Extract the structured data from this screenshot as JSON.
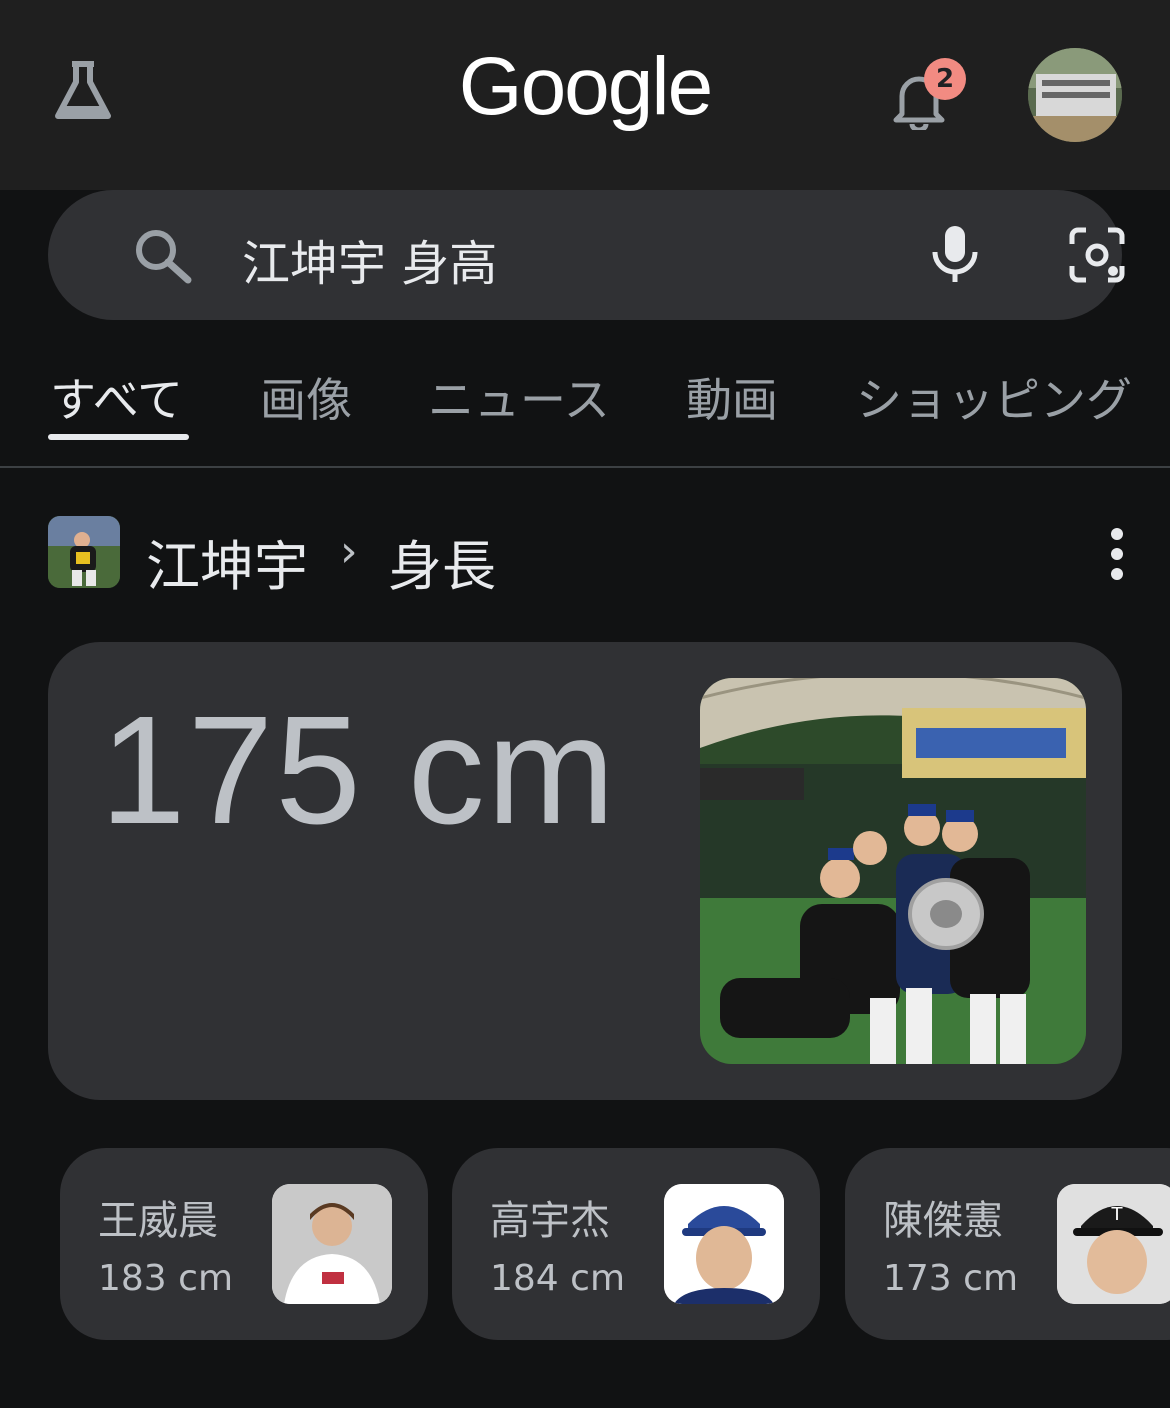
{
  "header": {
    "logo_text": "Google",
    "notification_count": "2",
    "labs_icon": "labs-flask-icon",
    "bell_icon": "bell-icon"
  },
  "search": {
    "query": "江坤宇 身高",
    "search_icon": "search-icon",
    "mic_icon": "microphone-icon",
    "lens_icon": "camera-lens-icon"
  },
  "tabs": [
    {
      "label": "すべて",
      "active": true
    },
    {
      "label": "画像"
    },
    {
      "label": "ニュース"
    },
    {
      "label": "動画"
    },
    {
      "label": "ショッピング"
    }
  ],
  "result": {
    "entity": "江坤宇",
    "separator": "›",
    "attribute": "身長",
    "value": "175 cm"
  },
  "related": [
    {
      "name": "王威晨",
      "height": "183 cm"
    },
    {
      "name": "高宇杰",
      "height": "184 cm"
    },
    {
      "name": "陳傑憲",
      "height": "173 cm"
    }
  ],
  "colors": {
    "background": "#111213",
    "header": "#1f1f1f",
    "card": "#303134",
    "badge": "#f28b82"
  }
}
